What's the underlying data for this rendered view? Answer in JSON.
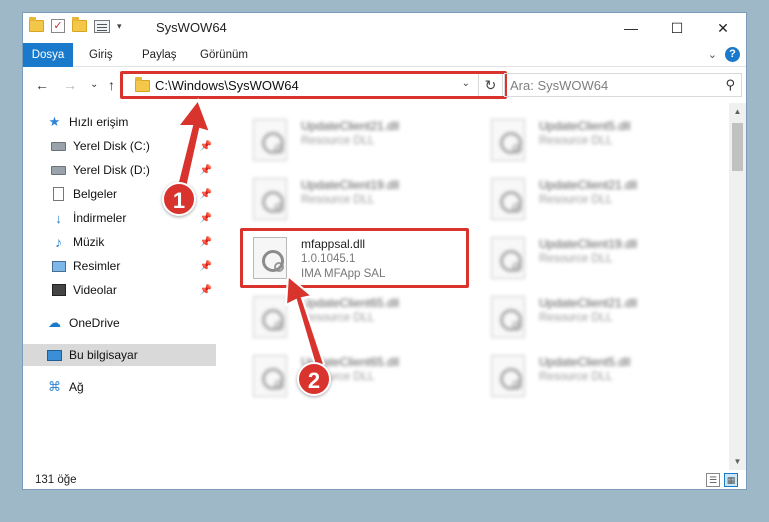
{
  "window": {
    "title": "SysWOW64",
    "qat_dropdown": "▾",
    "controls": {
      "minimize": "—",
      "maximize": "☐",
      "close": "✕"
    }
  },
  "ribbon": {
    "tabs": [
      "Dosya",
      "Giriş",
      "Paylaş",
      "Görünüm"
    ],
    "collapse": "⌄",
    "help": "?"
  },
  "nav": {
    "back": "←",
    "forward": "→",
    "recent": "⌄",
    "up": "↑",
    "address": "C:\\Windows\\SysWOW64",
    "address_drop": "⌄",
    "refresh": "↻",
    "search_placeholder": "Ara: SysWOW64",
    "search_icon": "⚲"
  },
  "sidebar": {
    "items": [
      {
        "label": "Hızlı erişim",
        "icon": "star-icon"
      },
      {
        "label": "Yerel Disk (C:)",
        "icon": "disk-icon",
        "pinned": true
      },
      {
        "label": "Yerel Disk (D:)",
        "icon": "disk-icon",
        "pinned": true
      },
      {
        "label": "Belgeler",
        "icon": "document-icon",
        "pinned": true
      },
      {
        "label": "İndirmeler",
        "icon": "download-icon",
        "pinned": true
      },
      {
        "label": "Müzik",
        "icon": "music-icon",
        "pinned": true
      },
      {
        "label": "Resimler",
        "icon": "pictures-icon",
        "pinned": true
      },
      {
        "label": "Videolar",
        "icon": "videos-icon",
        "pinned": true
      },
      {
        "label": "OneDrive",
        "icon": "cloud-icon"
      },
      {
        "label": "Bu bilgisayar",
        "icon": "computer-icon",
        "selected": true
      },
      {
        "label": "Ağ",
        "icon": "network-icon"
      }
    ],
    "pin_glyph": "📌"
  },
  "files": {
    "left": [
      {
        "name": "UpdateClient21.dll",
        "l2": "Resource DLL",
        "l3": ""
      },
      {
        "name": "UpdateClient19.dll",
        "l2": "Resource DLL",
        "l3": ""
      },
      {
        "name": "mfappsal.dll",
        "l2": "1.0.1045.1",
        "l3": "IMA MFApp SAL"
      },
      {
        "name": "UpdateClient65.dll",
        "l2": "Resource DLL",
        "l3": ""
      },
      {
        "name": "UpdateClient65.dll",
        "l2": "Resource DLL",
        "l3": ""
      }
    ],
    "right": [
      {
        "name": "UpdateClient5.dll",
        "l2": "Resource DLL"
      },
      {
        "name": "UpdateClient21.dll",
        "l2": "Resource DLL"
      },
      {
        "name": "UpdateClient19.dll",
        "l2": "Resource DLL"
      },
      {
        "name": "UpdateClient21.dll",
        "l2": "Resource DLL"
      },
      {
        "name": "UpdateClient5.dll",
        "l2": "Resource DLL"
      }
    ]
  },
  "scrollbar": {
    "up": "▲",
    "down": "▼"
  },
  "status": {
    "count": "131 öğe",
    "details_view": "☰",
    "tiles_view": "▦"
  },
  "annotations": {
    "step1": "1",
    "step2": "2"
  },
  "colors": {
    "accent": "#1979ca",
    "highlight": "#d9332d"
  }
}
